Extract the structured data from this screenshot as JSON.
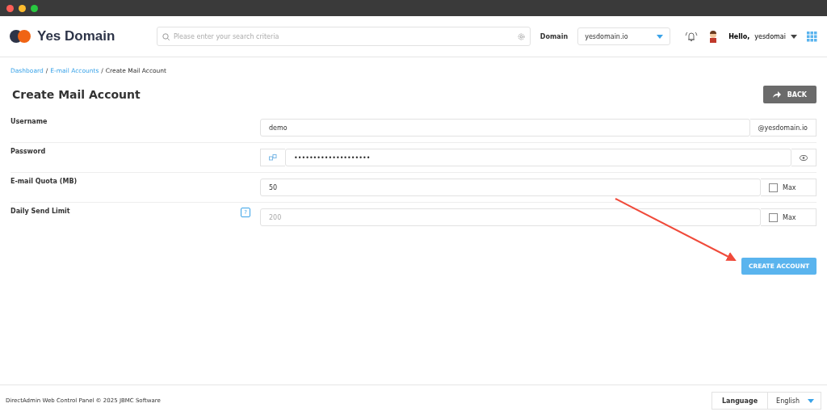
{
  "brand": {
    "name": "Yes Domain"
  },
  "search": {
    "placeholder": "Please enter your search criteria"
  },
  "domain": {
    "label": "Domain",
    "value": "yesdomain.io"
  },
  "user": {
    "greeting": "Hello,",
    "name": "yesdomai"
  },
  "breadcrumb": [
    {
      "label": "Dashboard",
      "link": true
    },
    {
      "label": "E-mail Accounts",
      "link": true
    },
    {
      "label": "Create Mail Account",
      "link": false
    }
  ],
  "breadcrumb_separator": "/",
  "title": "Create Mail Account",
  "back_button": "BACK",
  "fields": [
    {
      "kind": "suffix",
      "label": "Username",
      "value": "demo",
      "suffix": "@yesdomain.io"
    },
    {
      "kind": "password",
      "label": "Password",
      "value": "••••••••••••••••••••"
    },
    {
      "kind": "max",
      "label": "E-mail Quota (MB)",
      "value": "50",
      "max_label": "Max",
      "checked": false
    },
    {
      "kind": "max",
      "label": "Daily Send Limit",
      "placeholder": "200",
      "max_label": "Max",
      "checked": false,
      "help": "?"
    }
  ],
  "submit_button": "CREATE ACCOUNT",
  "footer": {
    "copyright": "DirectAdmin Web Control Panel © 2025 JBMC Software",
    "language_label": "Language",
    "language": "English"
  }
}
